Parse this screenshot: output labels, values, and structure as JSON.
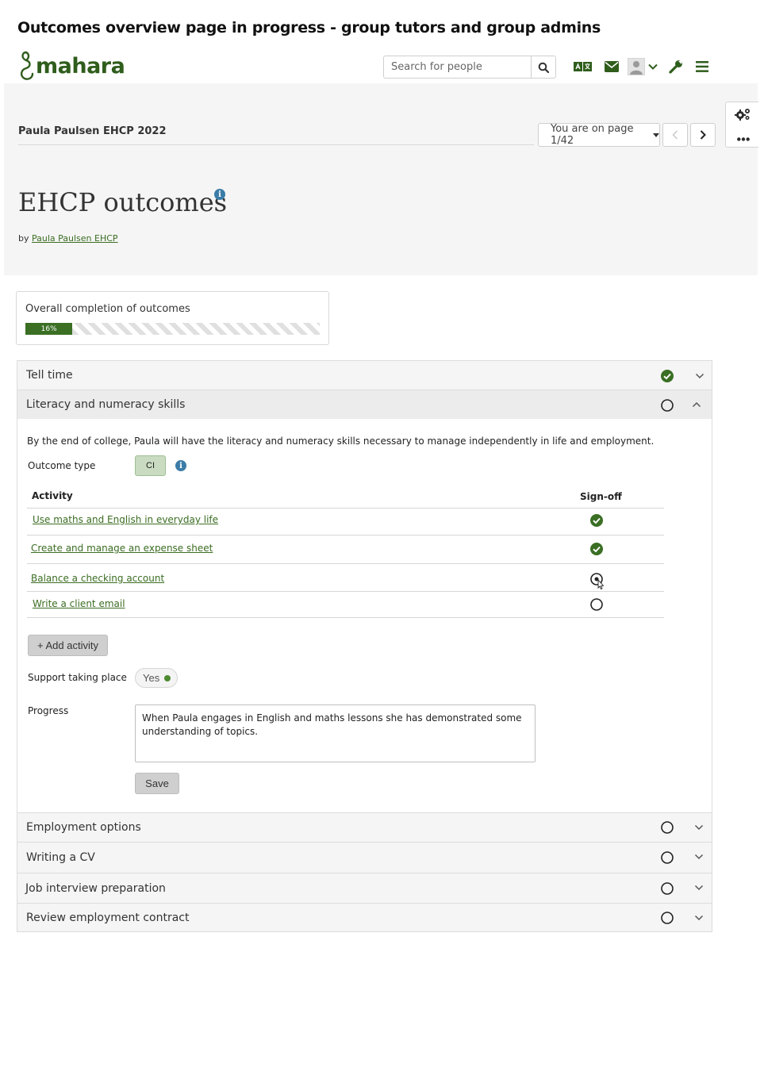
{
  "caption": "Outcomes overview page in progress - group tutors and group admins",
  "header": {
    "logo_text": "mahara",
    "search_placeholder": "Search for people",
    "icons": [
      "search-icon",
      "language-icon",
      "mail-icon",
      "user-avatar-icon",
      "chevron-down-icon",
      "wrench-icon",
      "menu-icon"
    ]
  },
  "page": {
    "collection_title": "Paula Paulsen EHCP 2022",
    "page_selector": "You are on page 1/42",
    "title": "EHCP outcomes",
    "by_prefix": "by",
    "author": "Paula Paulsen EHCP"
  },
  "completion": {
    "label": "Overall completion of outcomes",
    "percent": 16,
    "percent_label": "16%"
  },
  "outcomes": [
    {
      "title": "Tell time",
      "status": "complete",
      "expanded": false
    },
    {
      "title": "Literacy and numeracy skills",
      "status": "incomplete",
      "expanded": true
    },
    {
      "title": "Employment options",
      "status": "incomplete",
      "expanded": false
    },
    {
      "title": "Writing a CV",
      "status": "incomplete",
      "expanded": false
    },
    {
      "title": "Job interview preparation",
      "status": "incomplete",
      "expanded": false
    },
    {
      "title": "Review employment contract",
      "status": "incomplete",
      "expanded": false
    }
  ],
  "detail": {
    "description": "By the end of college, Paula will have the literacy and numeracy skills necessary to manage independently in life and employment.",
    "outcome_type_label": "Outcome type",
    "outcome_type_value": "CI",
    "table": {
      "col_activity": "Activity",
      "col_signoff": "Sign-off",
      "rows": [
        {
          "activity": "Use maths and English in everyday life",
          "signed": true
        },
        {
          "activity": "Create and manage an expense sheet",
          "signed": true
        },
        {
          "activity": "Balance a checking account",
          "signed": false
        },
        {
          "activity": "Write a client email",
          "signed": false
        }
      ]
    },
    "add_activity_label": "+ Add activity",
    "support_label": "Support taking place",
    "support_value": "Yes",
    "progress_label": "Progress",
    "progress_text": "When Paula engages in English and maths lessons she has demonstrated some understanding of topics.",
    "save_label": "Save"
  },
  "colors": {
    "brand_green": "#3a6f24",
    "link_green": "#3b6d22",
    "info_blue": "#3c7ca8"
  }
}
